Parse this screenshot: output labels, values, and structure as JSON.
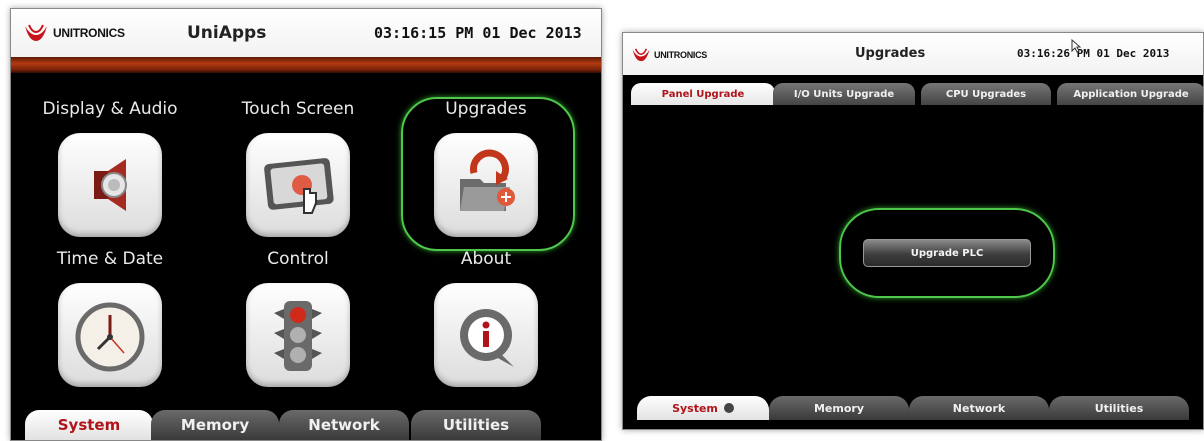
{
  "left": {
    "brand": "UNITRONICS",
    "title": "UniApps",
    "time": "03:16:15 PM",
    "date": "01 Dec 2013",
    "apps": [
      {
        "label": "Display & Audio",
        "icon": "speaker-icon"
      },
      {
        "label": "Touch Screen",
        "icon": "touch-screen-icon"
      },
      {
        "label": "Upgrades",
        "icon": "upgrade-folder-icon"
      },
      {
        "label": "Time & Date",
        "icon": "clock-icon"
      },
      {
        "label": "Control",
        "icon": "traffic-light-icon"
      },
      {
        "label": "About",
        "icon": "info-icon"
      }
    ],
    "tabs": [
      "System",
      "Memory",
      "Network",
      "Utilities"
    ],
    "active_tab": "System"
  },
  "right": {
    "brand": "UNITRONICS",
    "title": "Upgrades",
    "time": "03:16:26 PM",
    "date": "01 Dec 2013",
    "top_tabs": [
      "Panel Upgrade",
      "I/O Units Upgrade",
      "CPU Upgrades",
      "Application Upgrade"
    ],
    "active_top_tab": "Panel Upgrade",
    "button_label": "Upgrade PLC",
    "bottom_tabs": [
      "System",
      "Memory",
      "Network",
      "Utilities"
    ],
    "active_bottom_tab": "System"
  },
  "colors": {
    "accent_red": "#b0141a",
    "highlight_green": "#4ec84a",
    "background": "#000000"
  }
}
